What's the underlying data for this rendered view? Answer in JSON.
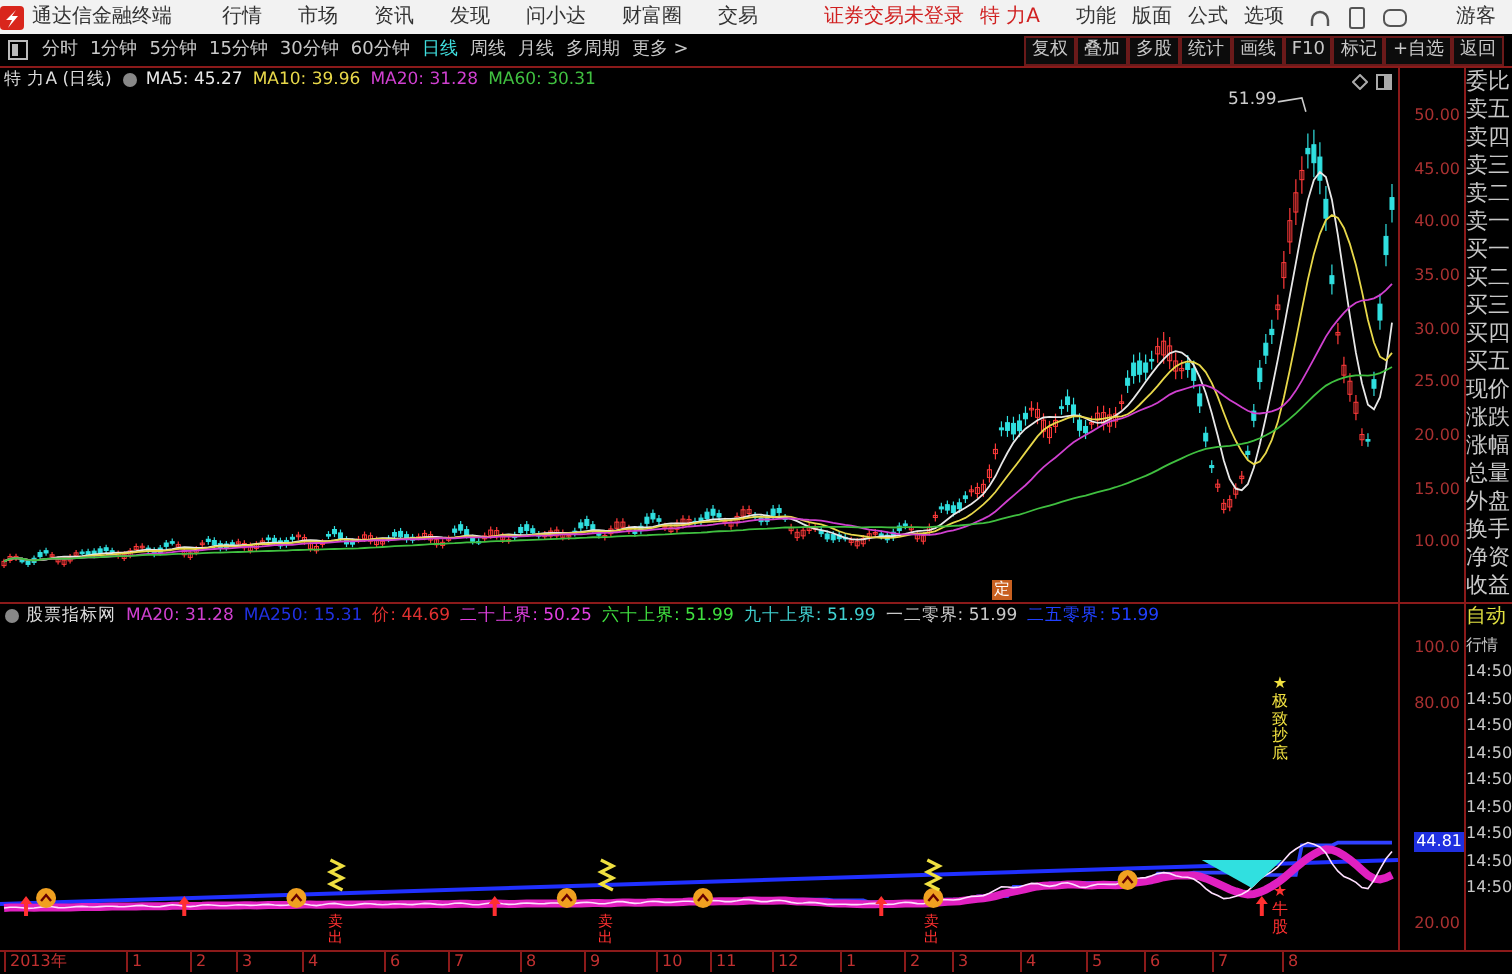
{
  "title_bar": {
    "app_name": "通达信金融终端",
    "menus": [
      "行情",
      "市场",
      "资讯",
      "发现",
      "问小达",
      "财富圈",
      "交易"
    ],
    "login_status": "证券交易未登录",
    "stock": "特 力A",
    "tools": [
      "功能",
      "版面",
      "公式",
      "选项"
    ],
    "user": "游客"
  },
  "period_bar": {
    "periods": [
      {
        "label": "分时",
        "selected": false
      },
      {
        "label": "1分钟",
        "selected": false
      },
      {
        "label": "5分钟",
        "selected": false
      },
      {
        "label": "15分钟",
        "selected": false
      },
      {
        "label": "30分钟",
        "selected": false
      },
      {
        "label": "60分钟",
        "selected": false
      },
      {
        "label": "日线",
        "selected": true
      },
      {
        "label": "周线",
        "selected": false
      },
      {
        "label": "月线",
        "selected": false
      },
      {
        "label": "多周期",
        "selected": false
      },
      {
        "label": "更多 >",
        "selected": false
      }
    ],
    "chart_tools": [
      "复权",
      "叠加",
      "多股",
      "统计",
      "画线",
      "F10",
      "标记",
      "+自选",
      "返回"
    ]
  },
  "main_chart": {
    "title": "特 力A (日线)",
    "indicators": [
      {
        "label": "MA5: 45.27",
        "color": "#e8e8e8"
      },
      {
        "label": "MA10: 39.96",
        "color": "#e8d84a"
      },
      {
        "label": "MA20: 31.28",
        "color": "#d040d0"
      },
      {
        "label": "MA60: 30.31",
        "color": "#40c040"
      }
    ],
    "peak_label": "51.99",
    "marker": "定",
    "y_axis": [
      "50.00",
      "45.00",
      "40.00",
      "35.00",
      "30.00",
      "25.00",
      "20.00",
      "15.00",
      "10.00"
    ]
  },
  "quote_panel": [
    "委比",
    "卖五",
    "卖四",
    "卖三",
    "卖二",
    "卖一",
    "买一",
    "买二",
    "买三",
    "买四",
    "买五",
    "现价",
    "涨跌",
    "涨幅",
    "总量",
    "外盘",
    "换手",
    "净资",
    "收益"
  ],
  "indicator_chart": {
    "name": "股票指标网",
    "values": [
      {
        "label": "MA20: 31.28",
        "color": "#d040d0"
      },
      {
        "label": "MA250: 15.31",
        "color": "#2030e0"
      },
      {
        "label": "价: 44.69",
        "color": "#e03030"
      },
      {
        "label": "二十上界: 50.25",
        "color": "#e040e0"
      },
      {
        "label": "六十上界: 51.99",
        "color": "#40e040"
      },
      {
        "label": "九十上界: 51.99",
        "color": "#40d0d0"
      },
      {
        "label": "一二零界: 51.99",
        "color": "#c8c8c8"
      },
      {
        "label": "二五零界: 51.99",
        "color": "#2040ff"
      }
    ],
    "top_signal": "★极致抄底",
    "bottom_signal": "★牛股",
    "sell_signals": [
      "卖出",
      "卖出",
      "卖出"
    ],
    "y_axis": [
      "100.0",
      "80.00",
      "20.00"
    ],
    "current_value": "44.81",
    "side_panel": [
      "自动",
      "行情",
      "14:50",
      "14:50",
      "14:50",
      "14:50",
      "14:50",
      "14:50",
      "14:50",
      "14:50",
      "14:50"
    ]
  },
  "time_axis": [
    "2013年",
    "1",
    "2",
    "3",
    "4",
    "6",
    "7",
    "8",
    "9",
    "10",
    "11",
    "12",
    "1",
    "2",
    "3",
    "4",
    "5",
    "6",
    "7",
    "8"
  ]
}
